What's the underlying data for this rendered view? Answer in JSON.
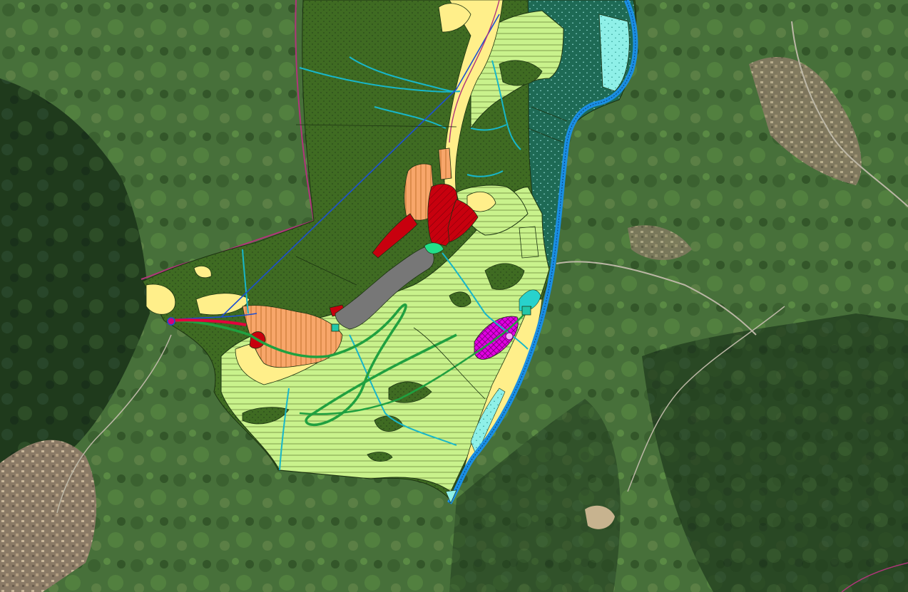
{
  "map": {
    "kind": "land-use zoning overlay on aerial imagery",
    "colors": {
      "forest": "#3f6b22",
      "forest_dark": "#2a4a1b",
      "agricultural": "#c9f28c",
      "agricultural_hatch": "#6b8a3a",
      "pasture": "#ffef8a",
      "residential": "#f8a66a",
      "residential_hatch": "#b5651d",
      "commercial": "#c8000e",
      "urban": "#777777",
      "special": "#e100e1",
      "river": "#1a8fe3",
      "stream": "#18b6c9",
      "road": "#20a040",
      "boundary": "#b0357a",
      "protected": "#1e6a55",
      "protected_dots": "#8fd7d0",
      "cyan_fill": "#8ff0e8",
      "aerial_green": "#47703a",
      "aerial_dark": "#1f3a1c",
      "settlement": "#9a8870"
    }
  }
}
